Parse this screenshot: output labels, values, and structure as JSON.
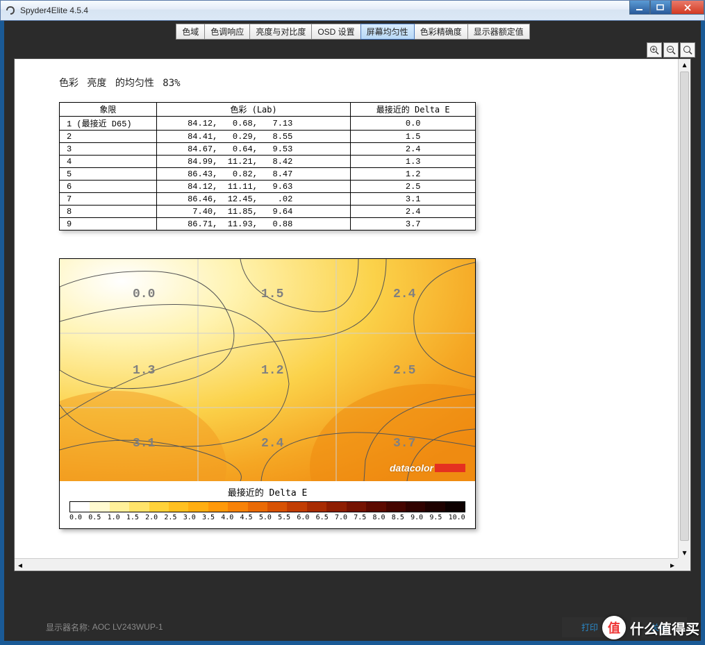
{
  "window": {
    "title": "Spyder4Elite 4.5.4"
  },
  "tabs": [
    {
      "label": "色域"
    },
    {
      "label": "色调响应"
    },
    {
      "label": "亮度与对比度"
    },
    {
      "label": "OSD 设置"
    },
    {
      "label": "屏幕均匀性",
      "active": true
    },
    {
      "label": "色彩精确度"
    },
    {
      "label": "显示器额定值"
    }
  ],
  "heading": "色彩 亮度 的均匀性 83%",
  "table": {
    "headers": [
      "象限",
      "色彩 (Lab)",
      "最接近的 Delta E"
    ],
    "rows": [
      {
        "q": "1 (最接近 D65)",
        "lab": "  84.12,   0.68,   7.13",
        "de": "0.0"
      },
      {
        "q": "2",
        "lab": "  84.41,   0.29,   8.55",
        "de": "1.5"
      },
      {
        "q": "3",
        "lab": "  84.67,   0.64,   9.53",
        "de": "2.4"
      },
      {
        "q": "4",
        "lab": "  84.99,  11.21,   8.42",
        "de": "1.3"
      },
      {
        "q": "5",
        "lab": "  86.43,   0.82,   8.47",
        "de": "1.2"
      },
      {
        "q": "6",
        "lab": "  84.12,  11.11,   9.63",
        "de": "2.5"
      },
      {
        "q": "7",
        "lab": "  86.46,  12.45,    .02",
        "de": "3.1"
      },
      {
        "q": "8",
        "lab": "   7.40,  11.85,   9.64",
        "de": "2.4"
      },
      {
        "q": "9",
        "lab": "  86.71,  11.93,   0.88",
        "de": "3.7"
      }
    ]
  },
  "chart_data": {
    "type": "heatmap",
    "title": "最接近的 Delta E",
    "grid": [
      [
        0.0,
        1.5,
        2.4
      ],
      [
        1.3,
        1.2,
        2.5
      ],
      [
        3.1,
        2.4,
        3.7
      ]
    ],
    "scale_ticks": [
      "0.0",
      "0.5",
      "1.0",
      "1.5",
      "2.0",
      "2.5",
      "3.0",
      "3.5",
      "4.0",
      "4.5",
      "5.0",
      "5.5",
      "6.0",
      "6.5",
      "7.0",
      "7.5",
      "8.0",
      "8.5",
      "9.0",
      "9.5",
      "10.0"
    ],
    "brand": "datacolor"
  },
  "footer": {
    "monitor_label": "显示器名称:",
    "monitor_value": "AOC LV243WUP-1",
    "print": "打印",
    "close": "关闭"
  },
  "watermark": {
    "badge": "值",
    "text": "什么值得买"
  }
}
